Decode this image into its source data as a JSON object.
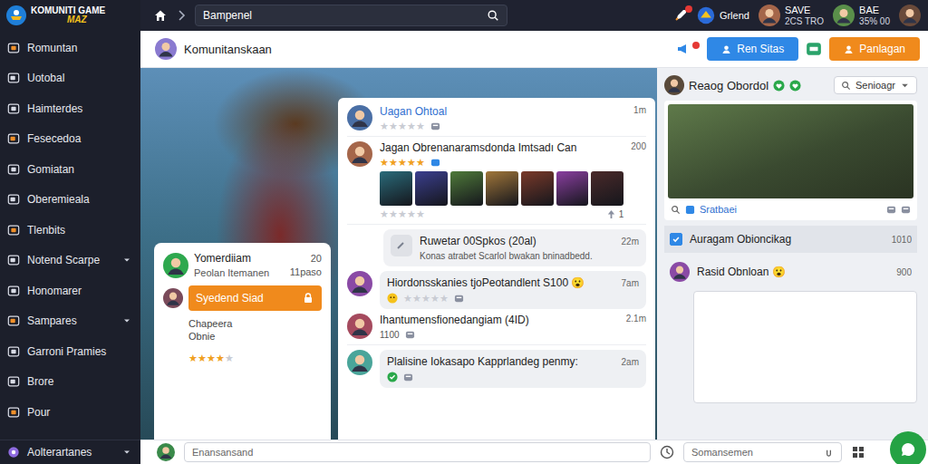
{
  "logo": {
    "title": "KOMUNITI GAME",
    "subtitle": "MAZ"
  },
  "search": {
    "value": "Bampenel"
  },
  "notifications": {
    "unread": true
  },
  "top_users": [
    {
      "line1": "Grlend"
    },
    {
      "line1": "SAVE",
      "line2": "2CS TRO"
    },
    {
      "line1": "BAE",
      "line2": "35% 00"
    }
  ],
  "sidebar": {
    "items": [
      {
        "label": "Romuntan",
        "expandable": false,
        "selected": false
      },
      {
        "label": "Uotobal",
        "expandable": false,
        "selected": false
      },
      {
        "label": "Haimterdes",
        "expandable": false,
        "selected": false
      },
      {
        "label": "Fesecedoa",
        "expandable": false,
        "selected": false
      },
      {
        "label": "Gomiatan",
        "expandable": false,
        "selected": false
      },
      {
        "label": "Oberemieala",
        "expandable": false,
        "selected": false
      },
      {
        "label": "Tlenbits",
        "expandable": false,
        "selected": false
      },
      {
        "label": "Notend Scarpe",
        "expandable": true,
        "selected": false
      },
      {
        "label": "Honomarer",
        "expandable": false,
        "selected": false
      },
      {
        "label": "Sampares",
        "expandable": true,
        "selected": false
      },
      {
        "label": "Garroni Pramies",
        "expandable": false,
        "selected": false
      },
      {
        "label": "Brore",
        "expandable": false,
        "selected": false
      },
      {
        "label": "Pour",
        "expandable": false,
        "selected": false
      }
    ],
    "footer": {
      "label": "Aolterartanes",
      "expandable": true
    }
  },
  "header": {
    "title": "Komunitanskaan",
    "alert": true,
    "buttons": [
      {
        "label": "Ren Sitas",
        "kind": "primary"
      },
      {
        "label": "Panlagan",
        "kind": "accent"
      }
    ]
  },
  "profile_card": {
    "name": "Yomerdiiam",
    "count": "20",
    "subtitle": "Peolan Itemanen",
    "meta": "11paso",
    "button": "Syedend Siad",
    "lines": [
      "Chapeera",
      "Obnie"
    ],
    "stars": 4
  },
  "feed": [
    {
      "kind": "post",
      "title": "Uagan Ohtoal",
      "time": "1m",
      "stars": 0,
      "highlight": true
    },
    {
      "kind": "gallery",
      "title": "Jagan Obrenanaramsdonda Imtsadı Can",
      "time": "200",
      "stars": 5,
      "gallery_stars": 0,
      "count": "1"
    },
    {
      "kind": "note",
      "title": "Ruwetar 00Spkos (20al)",
      "time": "22m",
      "body": "Konas atrabet Scarlol bwakan bninadbedd."
    },
    {
      "kind": "bubble",
      "title": "Hiordonsskanies tjoPeotandlent S100 😮",
      "time": "7am",
      "stars": 0,
      "verified": false
    },
    {
      "kind": "post",
      "title": "Ihantumensfionedangiam (4ID)",
      "time": "2.1m",
      "meta": "1100",
      "highlight": false
    },
    {
      "kind": "bubble",
      "title": "Plalisine Iokasapo Kapprlandeg penmy:",
      "time": "2am",
      "verified": true
    }
  ],
  "right_panel": {
    "title": "Reaog Obordol",
    "filter": "Senioagr",
    "search_label": "Sratbaei",
    "rows": [
      {
        "kind": "checkbox",
        "title": "Auragam Obioncikag",
        "count": "1010",
        "checked": true
      },
      {
        "kind": "avatar",
        "title": "Rasid Obnloan 😮",
        "count": "900"
      }
    ]
  },
  "composer": {
    "placeholder": "Enansansand",
    "secondary_placeholder": "Somansemen"
  },
  "star": "★"
}
